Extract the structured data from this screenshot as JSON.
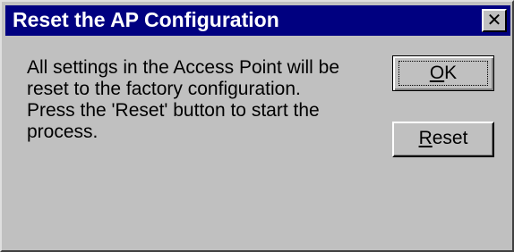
{
  "window": {
    "title": "Reset the AP Configuration",
    "close_glyph": "✕"
  },
  "message": {
    "lines": [
      "All settings in the Access Point will be",
      "reset to the factory configuration.",
      "Press the 'Reset' button to start the",
      "process."
    ]
  },
  "buttons": {
    "ok": {
      "mnemonic": "O",
      "rest": "K"
    },
    "reset": {
      "mnemonic": "R",
      "rest": "eset"
    }
  },
  "colors": {
    "titlebar": "#000080",
    "title_text": "#ffffff",
    "face": "#c0c0c0"
  }
}
